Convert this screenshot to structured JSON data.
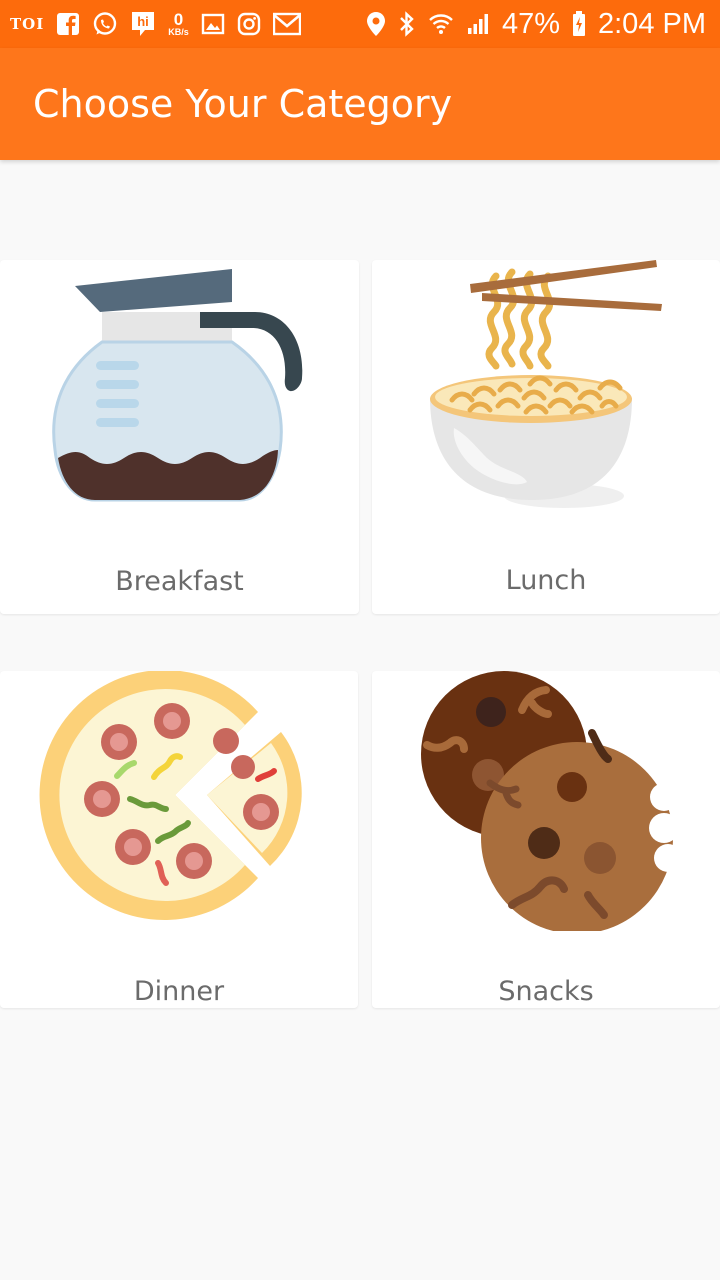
{
  "status_bar": {
    "left_icons": [
      "toi-icon",
      "facebook-icon",
      "whatsapp-icon",
      "hike-icon",
      "network-speed-icon",
      "gallery-icon",
      "instagram-icon",
      "gmail-icon"
    ],
    "toi_label": "TOI",
    "net_speed_value": "0",
    "net_speed_unit": "KB/s",
    "right_icons": [
      "location-icon",
      "bluetooth-icon",
      "wifi-icon",
      "signal-icon",
      "battery-charging-icon"
    ],
    "battery": "47%",
    "time": "2:04 PM"
  },
  "app_bar": {
    "title": "Choose Your Category",
    "color": "#fe761b"
  },
  "categories": [
    {
      "label": "Breakfast",
      "icon": "coffee-pot-icon"
    },
    {
      "label": "Lunch",
      "icon": "noodle-bowl-icon"
    },
    {
      "label": "Dinner",
      "icon": "pizza-icon"
    },
    {
      "label": "Snacks",
      "icon": "cookies-icon"
    }
  ]
}
